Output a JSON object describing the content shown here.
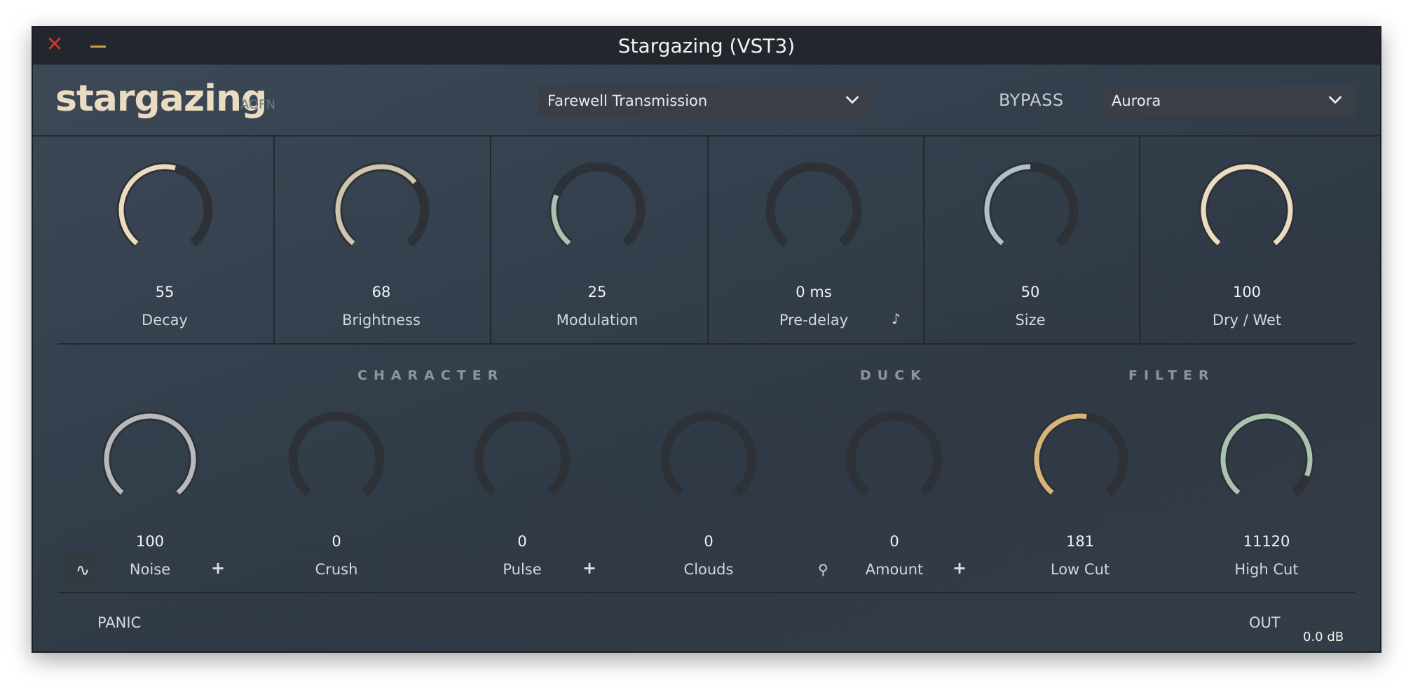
{
  "window": {
    "title": "Stargazing (VST3)"
  },
  "brand": {
    "name": "stargazing",
    "maker": "AOFN"
  },
  "header": {
    "preset": "Farewell Transmission",
    "bypass_label": "BYPASS",
    "mode": "Aurora"
  },
  "colors": {
    "cream": "#eadcbf",
    "sand": "#cfc5ae",
    "sage": "#a9c3b0",
    "steel": "#aebfd0",
    "silver": "#b7b9bd",
    "gold": "#d6b47a",
    "track": "#2e3238"
  },
  "top_knobs": [
    {
      "value": "55",
      "label": "Decay",
      "fraction": 0.55,
      "color": "cream"
    },
    {
      "value": "68",
      "label": "Brightness",
      "fraction": 0.68,
      "color": "sand"
    },
    {
      "value": "25",
      "label": "Modulation",
      "fraction": 0.25,
      "color": "sage"
    },
    {
      "value": "0 ms",
      "label": "Pre-delay",
      "fraction": 0.0,
      "color": "cream",
      "icon": "music-note-icon"
    },
    {
      "value": "50",
      "label": "Size",
      "fraction": 0.5,
      "color": "steel"
    },
    {
      "value": "100",
      "label": "Dry / Wet",
      "fraction": 1.0,
      "color": "cream"
    }
  ],
  "sections": {
    "character": "CHARACTER",
    "duck": "DUCK",
    "filter": "FILTER"
  },
  "bottom_knobs": [
    {
      "value": "100",
      "label": "Noise",
      "fraction": 1.0,
      "color": "silver"
    },
    {
      "value": "0",
      "label": "Crush",
      "fraction": 0.0,
      "color": "silver"
    },
    {
      "value": "0",
      "label": "Pulse",
      "fraction": 0.0,
      "color": "silver"
    },
    {
      "value": "0",
      "label": "Clouds",
      "fraction": 0.0,
      "color": "silver"
    },
    {
      "value": "0",
      "label": "Amount",
      "fraction": 0.0,
      "color": "silver"
    },
    {
      "value": "181",
      "label": "Low Cut",
      "fraction": 0.53,
      "color": "gold"
    },
    {
      "value": "11120",
      "label": "High Cut",
      "fraction": 0.9,
      "color": "sage"
    }
  ],
  "footer": {
    "panic": "PANIC",
    "out_label": "OUT",
    "out_value": "0.0 dB"
  },
  "icons": {
    "close": "✕",
    "noise_wave": "∿",
    "plus": "+",
    "link": "⚲",
    "note": "♪"
  }
}
